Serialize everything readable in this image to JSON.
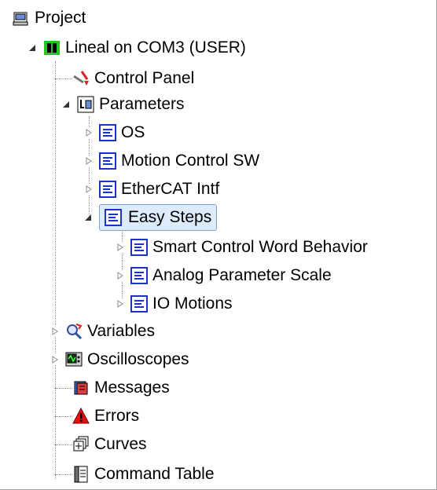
{
  "tree": {
    "root": "Project",
    "drive": "Lineal on COM3 (USER)",
    "control_panel": "Control Panel",
    "parameters": "Parameters",
    "os": "OS",
    "motion_control_sw": "Motion Control SW",
    "ethercat_intf": "EtherCAT Intf",
    "easy_steps": "Easy Steps",
    "smart_control_word": "Smart Control Word Behavior",
    "analog_parameter_scale": "Analog Parameter Scale",
    "io_motions": "IO Motions",
    "variables": "Variables",
    "oscilloscopes": "Oscilloscopes",
    "messages": "Messages",
    "errors": "Errors",
    "curves": "Curves",
    "command_table": "Command Table"
  },
  "colors": {
    "selection_bg": "#dcecfc",
    "selection_border": "#7da2ce",
    "param_icon": "#1b35c9",
    "drive_icon": "#22c822"
  }
}
